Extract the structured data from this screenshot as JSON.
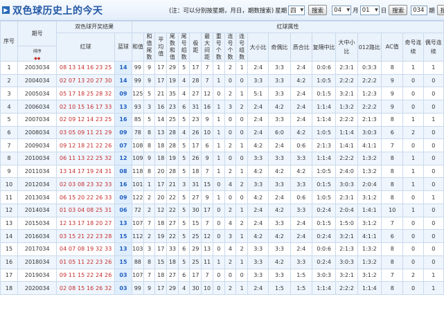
{
  "header": {
    "title": "双色球历史上的今天",
    "note": "(注：可以分别按星期，月日，期数搜索)",
    "weekday_label": "星期",
    "weekday_value": "四",
    "search1": "搜索",
    "month_value": "04",
    "month_label": "月",
    "day_value": "01",
    "day_label": "日",
    "search2": "搜索",
    "period_value": "034",
    "period_label": "期",
    "search3": "搜索"
  },
  "columns": {
    "seq": "序号",
    "issue": "期号",
    "sort_label": "排序",
    "group_result": "双色球开奖结果",
    "red": "红球",
    "blue": "蓝球",
    "group_attr": "红球属性",
    "sum": "和值",
    "sum_tail": "和值尾数",
    "avg": "平均值",
    "tail_sum": "尾数和值",
    "tail_group": "尾号组数",
    "max_gap": "极距",
    "max_range": "最大间距",
    "repeat": "重号个数",
    "consec": "连号个数",
    "consec_group": "连号组数",
    "bigsmall": "大小比",
    "oddeven": "奇偶比",
    "primecomp": "质合比",
    "mod3": "复隔中比",
    "bms": "大中小比",
    "r012": "012路比",
    "ac": "AC值",
    "odd_consec": "奇号连续",
    "even_consec": "偶号连续"
  },
  "rows": [
    {
      "seq": "1",
      "issue": "2003034",
      "red": "08 13 14 16 23 25",
      "blue": "14",
      "sum": "99",
      "tail": "9",
      "avg": "17",
      "tsum": "29",
      "tgrp": "5",
      "gap": "17",
      "mgap": "7",
      "rep": "1",
      "con": "2",
      "cgrp": "1",
      "bs": "2:4",
      "oe": "3:3",
      "pc": "2:4",
      "m3": "0:0:6",
      "bms": "2:3:1",
      "r012": "0:3:3",
      "ac": "8",
      "oc": "1",
      "ec": "1"
    },
    {
      "seq": "2",
      "issue": "2004034",
      "red": "02 07 13 20 27 30",
      "blue": "14",
      "sum": "99",
      "tail": "9",
      "avg": "17",
      "tsum": "19",
      "tgrp": "4",
      "gap": "28",
      "mgap": "7",
      "rep": "1",
      "con": "0",
      "cgrp": "0",
      "bs": "3:3",
      "oe": "3:3",
      "pc": "4:2",
      "m3": "1:0:5",
      "bms": "2:2:2",
      "r012": "2:2:2",
      "ac": "9",
      "oc": "0",
      "ec": "0"
    },
    {
      "seq": "3",
      "issue": "2005034",
      "red": "05 17 18 25 28 32",
      "blue": "09",
      "sum": "125",
      "tail": "5",
      "avg": "21",
      "tsum": "35",
      "tgrp": "4",
      "gap": "27",
      "mgap": "12",
      "rep": "0",
      "con": "2",
      "cgrp": "1",
      "bs": "5:1",
      "oe": "3:3",
      "pc": "2:4",
      "m3": "0:1:5",
      "bms": "3:2:1",
      "r012": "1:2:3",
      "ac": "9",
      "oc": "0",
      "ec": "0"
    },
    {
      "seq": "4",
      "issue": "2006034",
      "red": "02 10 15 16 17 33",
      "blue": "13",
      "sum": "93",
      "tail": "3",
      "avg": "16",
      "tsum": "23",
      "tgrp": "6",
      "gap": "31",
      "mgap": "16",
      "rep": "1",
      "con": "3",
      "cgrp": "2",
      "bs": "2:4",
      "oe": "4:2",
      "pc": "2:4",
      "m3": "1:1:4",
      "bms": "1:3:2",
      "r012": "2:2:2",
      "ac": "9",
      "oc": "0",
      "ec": "0"
    },
    {
      "seq": "5",
      "issue": "2007034",
      "red": "02 09 12 14 23 25",
      "blue": "16",
      "sum": "85",
      "tail": "5",
      "avg": "14",
      "tsum": "25",
      "tgrp": "5",
      "gap": "23",
      "mgap": "9",
      "rep": "1",
      "con": "0",
      "cgrp": "0",
      "bs": "2:4",
      "oe": "3:3",
      "pc": "2:4",
      "m3": "1:1:4",
      "bms": "2:2:2",
      "r012": "2:1:3",
      "ac": "8",
      "oc": "1",
      "ec": "1"
    },
    {
      "seq": "6",
      "issue": "2008034",
      "red": "03 05 09 11 21 29",
      "blue": "09",
      "sum": "78",
      "tail": "8",
      "avg": "13",
      "tsum": "28",
      "tgrp": "4",
      "gap": "26",
      "mgap": "10",
      "rep": "1",
      "con": "0",
      "cgrp": "0",
      "bs": "2:4",
      "oe": "6:0",
      "pc": "4:2",
      "m3": "1:0:5",
      "bms": "1:1:4",
      "r012": "3:0:3",
      "ac": "6",
      "oc": "2",
      "ec": "0"
    },
    {
      "seq": "7",
      "issue": "2009034",
      "red": "09 12 18 21 22 26",
      "blue": "07",
      "sum": "108",
      "tail": "8",
      "avg": "18",
      "tsum": "28",
      "tgrp": "5",
      "gap": "17",
      "mgap": "6",
      "rep": "1",
      "con": "2",
      "cgrp": "1",
      "bs": "4:2",
      "oe": "2:4",
      "pc": "0:6",
      "m3": "2:1:3",
      "bms": "1:4:1",
      "r012": "4:1:1",
      "ac": "7",
      "oc": "0",
      "ec": "0"
    },
    {
      "seq": "8",
      "issue": "2010034",
      "red": "06 11 13 22 25 32",
      "blue": "12",
      "sum": "109",
      "tail": "9",
      "avg": "18",
      "tsum": "19",
      "tgrp": "5",
      "gap": "26",
      "mgap": "9",
      "rep": "1",
      "con": "0",
      "cgrp": "0",
      "bs": "3:3",
      "oe": "3:3",
      "pc": "3:3",
      "m3": "1:1:4",
      "bms": "2:2:2",
      "r012": "1:3:2",
      "ac": "8",
      "oc": "1",
      "ec": "0"
    },
    {
      "seq": "9",
      "issue": "2011034",
      "red": "13 14 17 19 24 31",
      "blue": "08",
      "sum": "118",
      "tail": "8",
      "avg": "20",
      "tsum": "28",
      "tgrp": "5",
      "gap": "18",
      "mgap": "7",
      "rep": "1",
      "con": "2",
      "cgrp": "1",
      "bs": "4:2",
      "oe": "4:2",
      "pc": "4:2",
      "m3": "1:0:5",
      "bms": "2:4:0",
      "r012": "1:3:2",
      "ac": "8",
      "oc": "1",
      "ec": "0"
    },
    {
      "seq": "10",
      "issue": "2012034",
      "red": "02 03 08 23 32 33",
      "blue": "16",
      "sum": "101",
      "tail": "1",
      "avg": "17",
      "tsum": "21",
      "tgrp": "3",
      "gap": "31",
      "mgap": "15",
      "rep": "0",
      "con": "4",
      "cgrp": "2",
      "bs": "3:3",
      "oe": "3:3",
      "pc": "3:3",
      "m3": "0:1:5",
      "bms": "3:0:3",
      "r012": "2:0:4",
      "ac": "8",
      "oc": "1",
      "ec": "0"
    },
    {
      "seq": "11",
      "issue": "2013034",
      "red": "06 15 20 22 26 33",
      "blue": "09",
      "sum": "122",
      "tail": "2",
      "avg": "20",
      "tsum": "22",
      "tgrp": "5",
      "gap": "27",
      "mgap": "9",
      "rep": "1",
      "con": "0",
      "cgrp": "0",
      "bs": "4:2",
      "oe": "2:4",
      "pc": "0:6",
      "m3": "1:0:5",
      "bms": "2:3:1",
      "r012": "3:1:2",
      "ac": "8",
      "oc": "0",
      "ec": "1"
    },
    {
      "seq": "12",
      "issue": "2014034",
      "red": "01 03 04 08 25 31",
      "blue": "06",
      "sum": "72",
      "tail": "2",
      "avg": "12",
      "tsum": "22",
      "tgrp": "5",
      "gap": "30",
      "mgap": "17",
      "rep": "0",
      "con": "2",
      "cgrp": "1",
      "bs": "2:4",
      "oe": "4:2",
      "pc": "3:3",
      "m3": "0:2:4",
      "bms": "2:0:4",
      "r012": "1:4:1",
      "ac": "10",
      "oc": "1",
      "ec": "0"
    },
    {
      "seq": "13",
      "issue": "2015034",
      "red": "12 13 17 18 20 27",
      "blue": "13",
      "sum": "107",
      "tail": "7",
      "avg": "18",
      "tsum": "27",
      "tgrp": "5",
      "gap": "15",
      "mgap": "7",
      "rep": "0",
      "con": "4",
      "cgrp": "2",
      "bs": "2:4",
      "oe": "3:3",
      "pc": "2:4",
      "m3": "0:1:5",
      "bms": "1:5:0",
      "r012": "3:1:2",
      "ac": "7",
      "oc": "0",
      "ec": "0"
    },
    {
      "seq": "14",
      "issue": "2016034",
      "red": "03 15 21 22 23 28",
      "blue": "15",
      "sum": "112",
      "tail": "2",
      "avg": "19",
      "tsum": "22",
      "tgrp": "5",
      "gap": "25",
      "mgap": "12",
      "rep": "0",
      "con": "3",
      "cgrp": "1",
      "bs": "4:2",
      "oe": "4:2",
      "pc": "2:4",
      "m3": "0:2:4",
      "bms": "3:2:1",
      "r012": "4:1:1",
      "ac": "6",
      "oc": "0",
      "ec": "0"
    },
    {
      "seq": "15",
      "issue": "2017034",
      "red": "04 07 08 19 32 33",
      "blue": "13",
      "sum": "103",
      "tail": "3",
      "avg": "17",
      "tsum": "33",
      "tgrp": "6",
      "gap": "29",
      "mgap": "13",
      "rep": "0",
      "con": "4",
      "cgrp": "2",
      "bs": "3:3",
      "oe": "3:3",
      "pc": "2:4",
      "m3": "0:0:6",
      "bms": "2:1:3",
      "r012": "1:3:2",
      "ac": "8",
      "oc": "0",
      "ec": "0"
    },
    {
      "seq": "16",
      "issue": "2018034",
      "red": "01 05 11 22 23 26",
      "blue": "15",
      "sum": "88",
      "tail": "8",
      "avg": "15",
      "tsum": "18",
      "tgrp": "5",
      "gap": "25",
      "mgap": "11",
      "rep": "1",
      "con": "2",
      "cgrp": "1",
      "bs": "3:3",
      "oe": "4:2",
      "pc": "3:3",
      "m3": "0:2:4",
      "bms": "3:0:3",
      "r012": "1:3:2",
      "ac": "8",
      "oc": "0",
      "ec": "0"
    },
    {
      "seq": "17",
      "issue": "2019034",
      "red": "09 11 15 22 24 26",
      "blue": "03",
      "sum": "107",
      "tail": "7",
      "avg": "18",
      "tsum": "27",
      "tgrp": "6",
      "gap": "17",
      "mgap": "7",
      "rep": "0",
      "con": "0",
      "cgrp": "0",
      "bs": "3:3",
      "oe": "3:3",
      "pc": "1:5",
      "m3": "3:0:3",
      "bms": "3:2:1",
      "r012": "3:1:2",
      "ac": "7",
      "oc": "2",
      "ec": "1"
    },
    {
      "seq": "18",
      "issue": "2020034",
      "red": "02 08 15 16 26 32",
      "blue": "03",
      "sum": "99",
      "tail": "9",
      "avg": "17",
      "tsum": "29",
      "tgrp": "4",
      "gap": "30",
      "mgap": "10",
      "rep": "0",
      "con": "2",
      "cgrp": "1",
      "bs": "2:4",
      "oe": "1:5",
      "pc": "1:5",
      "m3": "1:1:4",
      "bms": "2:2:2",
      "r012": "1:1:4",
      "ac": "8",
      "oc": "0",
      "ec": "1"
    }
  ]
}
